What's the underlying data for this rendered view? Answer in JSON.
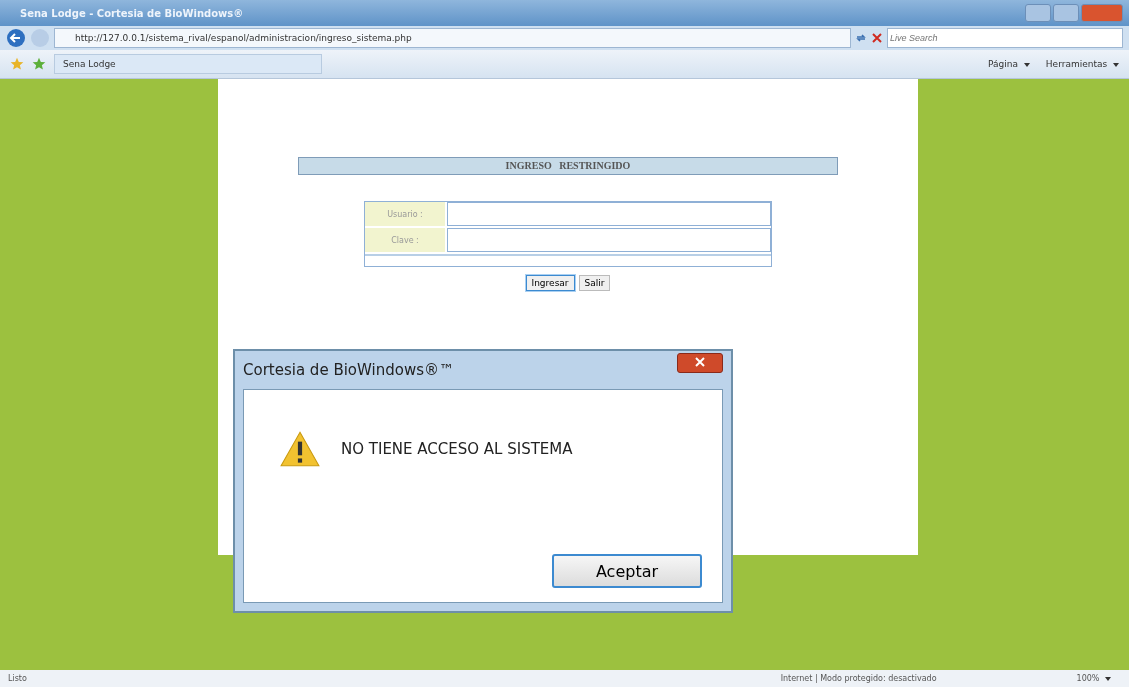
{
  "window": {
    "title": "Sena Lodge - Cortesia de BioWindows®"
  },
  "address_bar": {
    "url": "http://127.0.0.1/sistema_rival/espanol/administracion/ingreso_sistema.php"
  },
  "search": {
    "placeholder": "Live Search"
  },
  "tab": {
    "label": "Sena Lodge"
  },
  "command_bar": {
    "items": [
      "Página",
      "Herramientas"
    ]
  },
  "login": {
    "heading": "INGRESO   RESTRINGIDO",
    "fields": [
      {
        "label": "Usuario :"
      },
      {
        "label": "Clave :"
      }
    ],
    "buttons": [
      {
        "label": "Ingresar",
        "selected": true
      },
      {
        "label": "Salir",
        "selected": false
      }
    ]
  },
  "dialog": {
    "title": "Cortesia de BioWindows®™",
    "message": "NO TIENE ACCESO AL SISTEMA",
    "button": "Aceptar"
  },
  "status_bar": {
    "text": "Listo",
    "zone": "Internet | Modo protegido: desactivado",
    "zoom": "100%"
  }
}
